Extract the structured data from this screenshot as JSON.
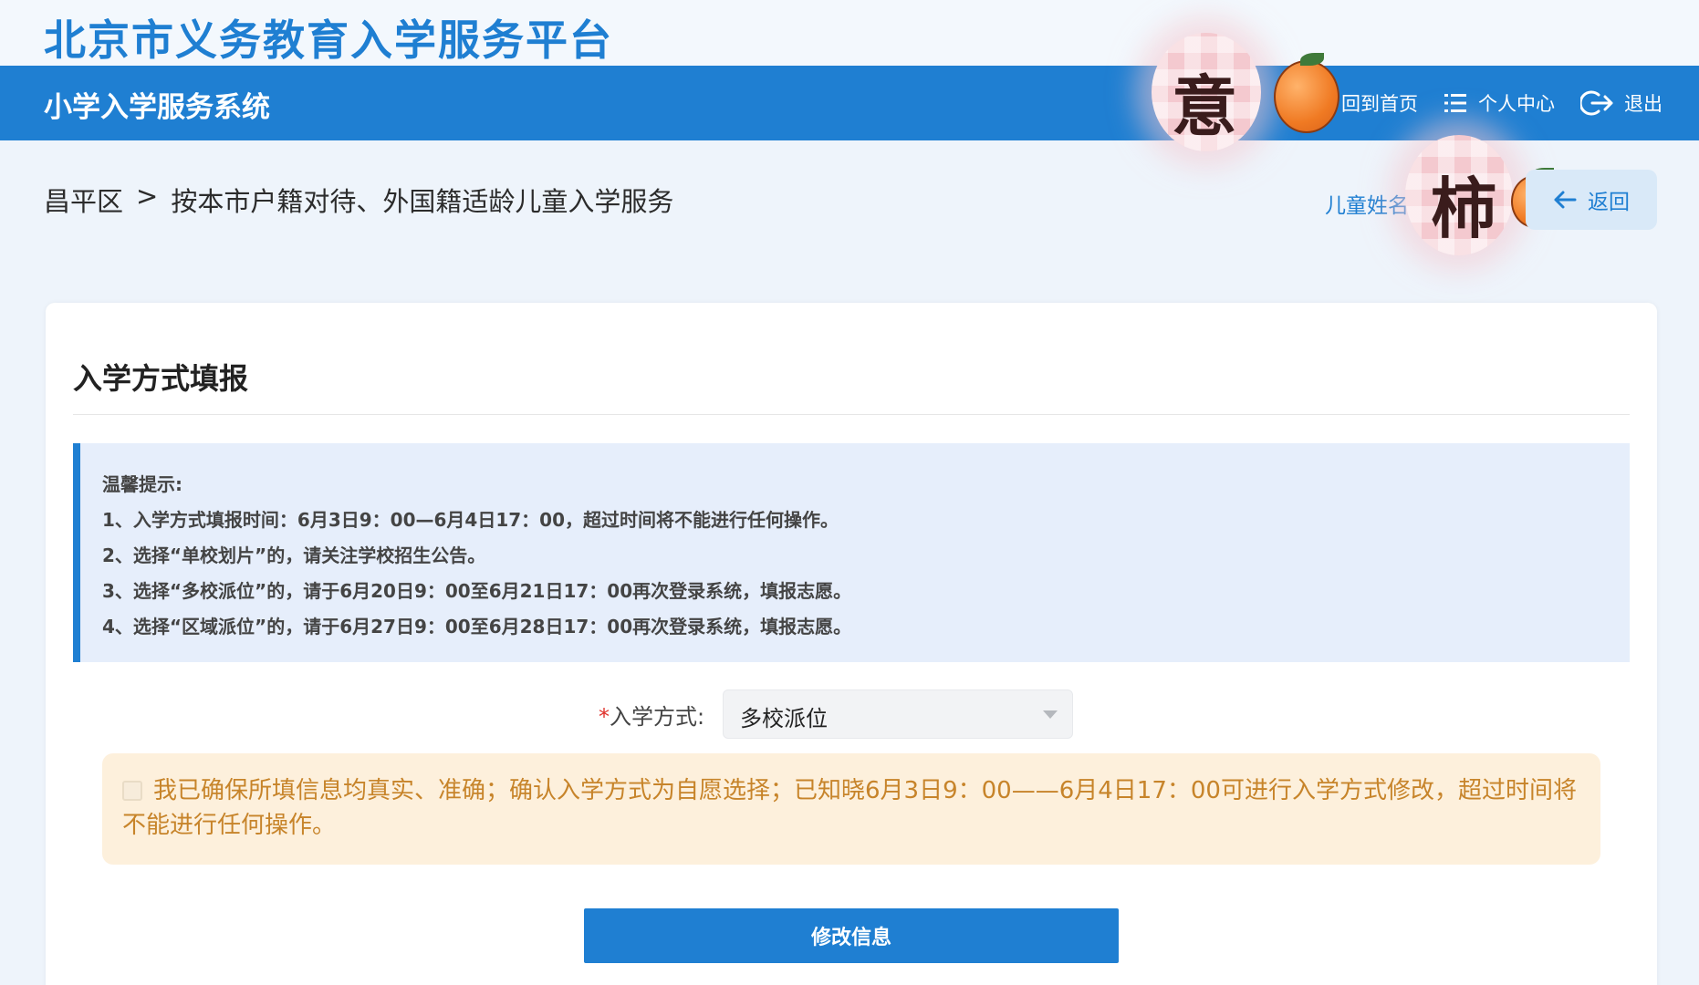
{
  "header": {
    "platform_title": "北京市义务教育入学服务平台",
    "system_title": "小学入学服务系统",
    "nav": [
      {
        "label": "回到首页",
        "icon": "home-icon"
      },
      {
        "label": "个人中心",
        "icon": "list-icon"
      },
      {
        "label": "退出",
        "icon": "logout-icon"
      }
    ]
  },
  "breadcrumb": {
    "district": "昌平区",
    "separator": ">",
    "service": "按本市户籍对待、外国籍适龄儿童入学服务"
  },
  "child_name_label": "儿童姓名",
  "back_label": "返回",
  "stickers": [
    "意",
    "柿"
  ],
  "card": {
    "title": "入学方式填报",
    "tips": [
      "温馨提示:",
      "1、入学方式填报时间：6月3日9：00—6月4日17：00，超过时间将不能进行任何操作。",
      "2、选择“单校划片”的，请关注学校招生公告。",
      "3、选择“多校派位”的，请于6月20日9：00至6月21日17：00再次登录系统，填报志愿。",
      "4、选择“区域派位”的，请于6月27日9：00至6月28日17：00再次登录系统，填报志愿。"
    ],
    "form": {
      "required_mark": "*",
      "label": "入学方式:",
      "selected_value": "多校派位"
    },
    "confirm_text": "我已确保所填信息均真实、准确；确认入学方式为自愿选择；已知晓6月3日9：00——6月4日17：00可进行入学方式修改，超过时间将不能进行任何操作。",
    "submit_label": "修改信息"
  },
  "colors": {
    "primary": "#1f7fd2",
    "tips_bg": "#e6eefb",
    "confirm_bg": "#fdf0dc",
    "confirm_text": "#c7842a"
  }
}
